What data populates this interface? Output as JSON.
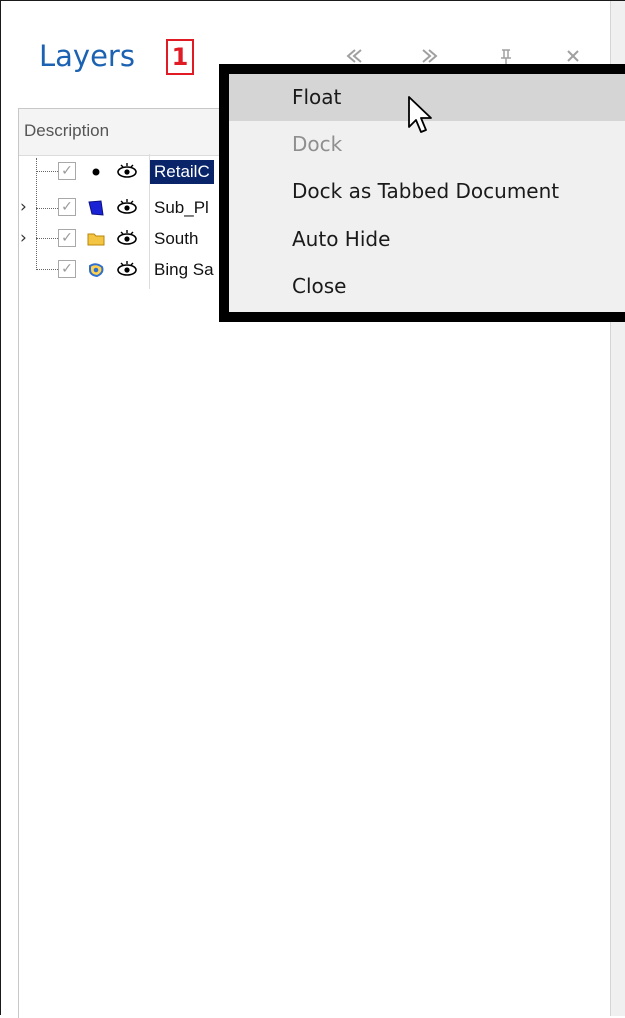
{
  "panel": {
    "title": "Layers",
    "badge": "1",
    "buttons": {
      "prev_icon": "double-chevron-left-icon",
      "next_icon": "double-chevron-right-icon",
      "pin_icon": "pin-icon",
      "close_icon": "close-icon"
    }
  },
  "tree": {
    "column_header": "Description",
    "rows": [
      {
        "label": "RetailC",
        "icon": "point-layer-icon",
        "checked": true,
        "visible": true,
        "selected": true,
        "expander": ""
      },
      {
        "label": "Sub_Pl",
        "icon": "polygon-layer-icon",
        "checked": true,
        "visible": true,
        "selected": false,
        "expander": "›"
      },
      {
        "label": "South",
        "icon": "folder-icon",
        "checked": true,
        "visible": true,
        "selected": false,
        "expander": "›"
      },
      {
        "label": "Bing Sa",
        "icon": "bing-map-icon",
        "checked": true,
        "visible": true,
        "selected": false,
        "expander": ""
      }
    ]
  },
  "context_menu": {
    "items": [
      {
        "label": "Float",
        "state": "hover"
      },
      {
        "label": "Dock",
        "state": "disabled"
      },
      {
        "label": "Dock as Tabbed Document",
        "state": "normal"
      },
      {
        "label": "Auto Hide",
        "state": "normal"
      },
      {
        "label": "Close",
        "state": "normal"
      }
    ]
  },
  "colors": {
    "title": "#1b62b3",
    "badge": "#e01b24",
    "selection": "#0a246a",
    "menu_hover": "#d5d5d5"
  }
}
